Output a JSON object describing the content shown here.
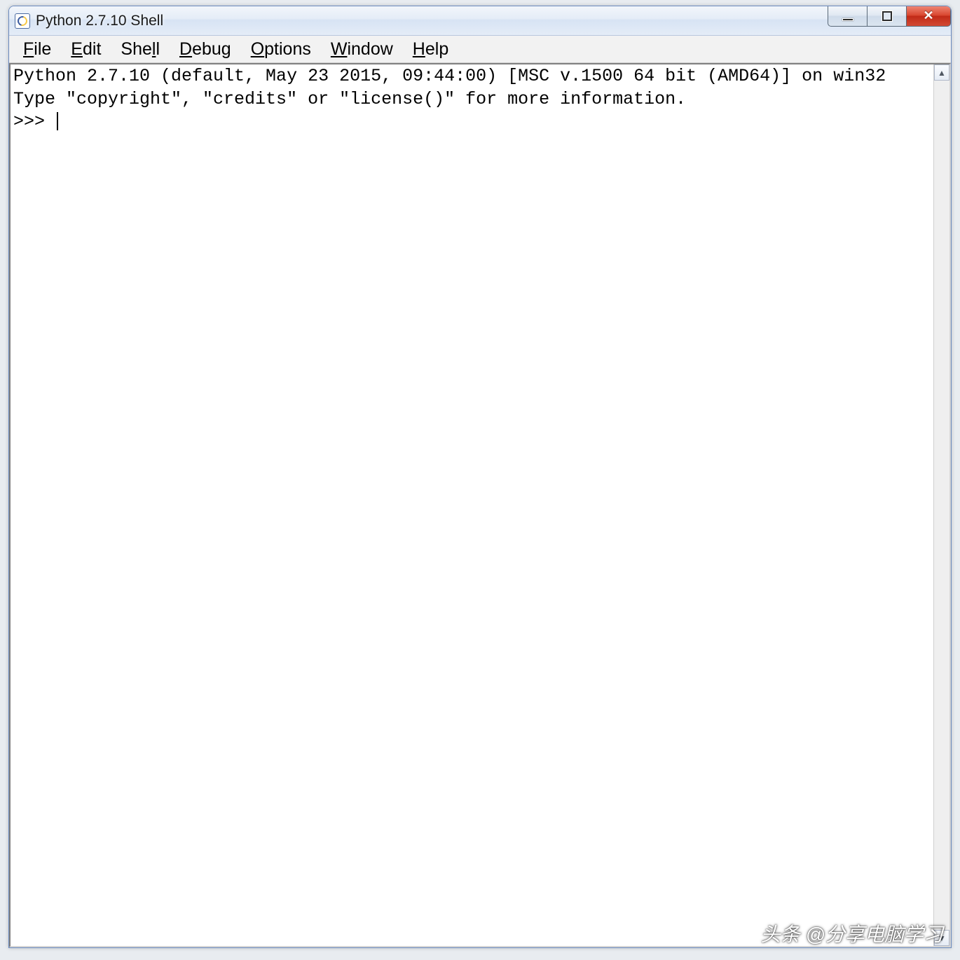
{
  "window": {
    "title": "Python 2.7.10 Shell"
  },
  "menu": {
    "file": "File",
    "edit": "Edit",
    "shell": "Shell",
    "debug": "Debug",
    "options": "Options",
    "window": "Window",
    "help": "Help"
  },
  "shell": {
    "line1": "Python 2.7.10 (default, May 23 2015, 09:44:00) [MSC v.1500 64 bit (AMD64)] on win32",
    "line2": "Type \"copyright\", \"credits\" or \"license()\" for more information.",
    "prompt": ">>> "
  },
  "watermark": "头条 @分享电脑学习"
}
